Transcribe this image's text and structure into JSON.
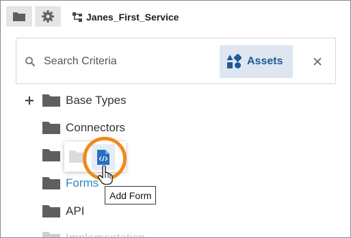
{
  "toolbar": {
    "folder_icon": "folder-icon",
    "gear_icon": "gear-icon",
    "service_icon": "service-tree-icon",
    "service_title": "Janes_First_Service"
  },
  "search": {
    "placeholder": "Search Criteria",
    "value": "",
    "assets_label": "Assets",
    "assets_icon": "assets-shapes-icon",
    "close_icon": "close-icon"
  },
  "tree": {
    "items": [
      {
        "label": "Base Types",
        "expander": "+"
      },
      {
        "label": "Connectors"
      },
      {
        "label": ""
      },
      {
        "label": "Forms"
      },
      {
        "label": "API"
      },
      {
        "label": "Implementation"
      }
    ]
  },
  "popup": {
    "action_icon": "add-form-file-icon",
    "tooltip": "Add Form"
  },
  "colors": {
    "accent": "#1e5a94",
    "accent_bg": "#dde6f1",
    "link": "#2d86c4",
    "highlight_ring": "#f08a1c",
    "folder": "#5f5f5f"
  }
}
